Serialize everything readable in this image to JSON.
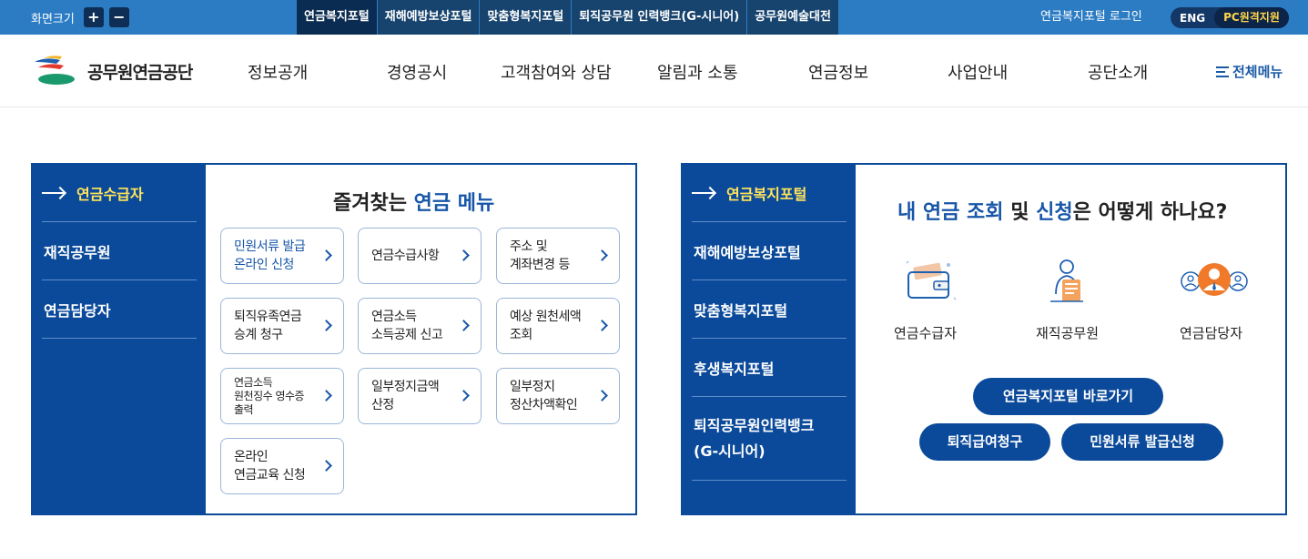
{
  "topbar": {
    "font_size_label": "화면크기",
    "zoom_in": "+",
    "zoom_out": "−",
    "portals": [
      "연금복지포털",
      "재해예방보상포털",
      "맞춤형복지포털",
      "퇴직공무원 인력뱅크(G-시니어)",
      "공무원예술대전"
    ],
    "login": "연금복지포털 로그인",
    "lang": "ENG",
    "pc_support": "PC원격지원"
  },
  "header": {
    "logo_text": "공무원연금공단",
    "nav": [
      "정보공개",
      "경영공시",
      "고객참여와 상담",
      "알림과 소통",
      "연금정보",
      "사업안내",
      "공단소개"
    ],
    "all_menu": "전체메뉴"
  },
  "left_panel": {
    "tabs": [
      "연금수급자",
      "재직공무원",
      "연금담당자"
    ],
    "title_prefix": "즐겨찾는",
    "title_highlight": "연금 메뉴",
    "buttons": [
      "민원서류 발급\n온라인 신청",
      "연금수급사항",
      "주소 및\n계좌변경 등",
      "퇴직유족연금\n승계 청구",
      "연금소득\n소득공제 신고",
      "예상 원천세액\n조회",
      "연금소득\n원천징수 영수증\n출력",
      "일부정지금액\n산정",
      "일부정지\n정산차액확인",
      "온라인\n연금교육 신청"
    ]
  },
  "right_panel": {
    "tabs": [
      "연금복지포털",
      "재해예방보상포털",
      "맞춤형복지포털",
      "후생복지포털",
      "퇴직공무원인력뱅크\n(G-시니어)"
    ],
    "title_part1": "내 연금 조회",
    "title_part2": "및",
    "title_part3": "신청",
    "title_part4": "은 어떻게 하나요?",
    "icons": [
      {
        "name": "wallet-icon",
        "label": "연금수급자"
      },
      {
        "name": "worker-icon",
        "label": "재직공무원"
      },
      {
        "name": "staff-icon",
        "label": "연금담당자"
      }
    ],
    "actions": [
      "연금복지포털 바로가기",
      "퇴직급여청구",
      "민원서류 발급신청"
    ]
  }
}
